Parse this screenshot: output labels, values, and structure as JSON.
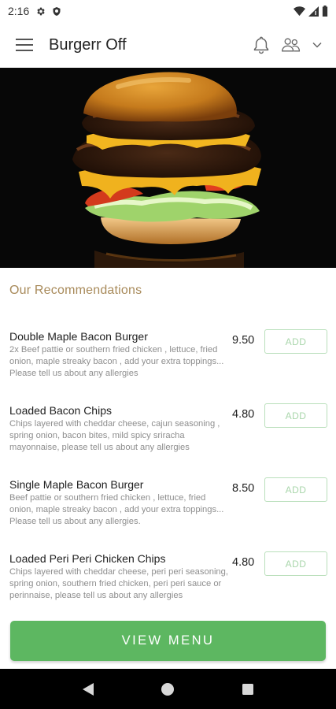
{
  "status_bar": {
    "time": "2:16",
    "icons": [
      "settings-gear-icon",
      "shield-icon",
      "wifi-icon",
      "signal-icon",
      "battery-icon"
    ]
  },
  "app_bar": {
    "title": "Burgerr Off",
    "icons": [
      "menu-icon",
      "bell-icon",
      "people-icon",
      "chevron-down-icon"
    ]
  },
  "hero": {
    "image": "burger photo"
  },
  "recommendations": {
    "title": "Our Recommendations",
    "items": [
      {
        "name": "Double Maple Bacon Burger",
        "description": "2x Beef pattie or southern fried chicken , lettuce, fried onion, maple streaky bacon , add your extra toppings... Please tell us about any allergies",
        "price": "9.50",
        "button": "ADD"
      },
      {
        "name": "Loaded Bacon Chips",
        "description": "Chips layered with cheddar cheese, cajun seasoning , spring onion, bacon bites, mild spicy sriracha mayonnaise,  please tell us about any allergies",
        "price": "4.80",
        "button": "ADD"
      },
      {
        "name": "Single Maple Bacon Burger",
        "description": "Beef pattie or southern fried chicken , lettuce, fried onion, maple streaky bacon ,  add your extra toppings... Please tell us about any allergies.",
        "price": "8.50",
        "button": "ADD"
      },
      {
        "name": "Loaded Peri Peri Chicken Chips",
        "description": "Chips layered with cheddar cheese, peri peri seasoning, spring onion, southern fried chicken, peri peri sauce or perinnaise,   please tell us about any allergies",
        "price": "4.80",
        "button": "ADD"
      }
    ]
  },
  "view_menu_label": "VIEW MENU",
  "nav_bar": {
    "icons": [
      "back-icon",
      "home-icon",
      "recents-icon"
    ]
  },
  "colors": {
    "accent_green": "#5db761",
    "add_border": "#b9dfbb",
    "section_title": "#a88a5a"
  }
}
